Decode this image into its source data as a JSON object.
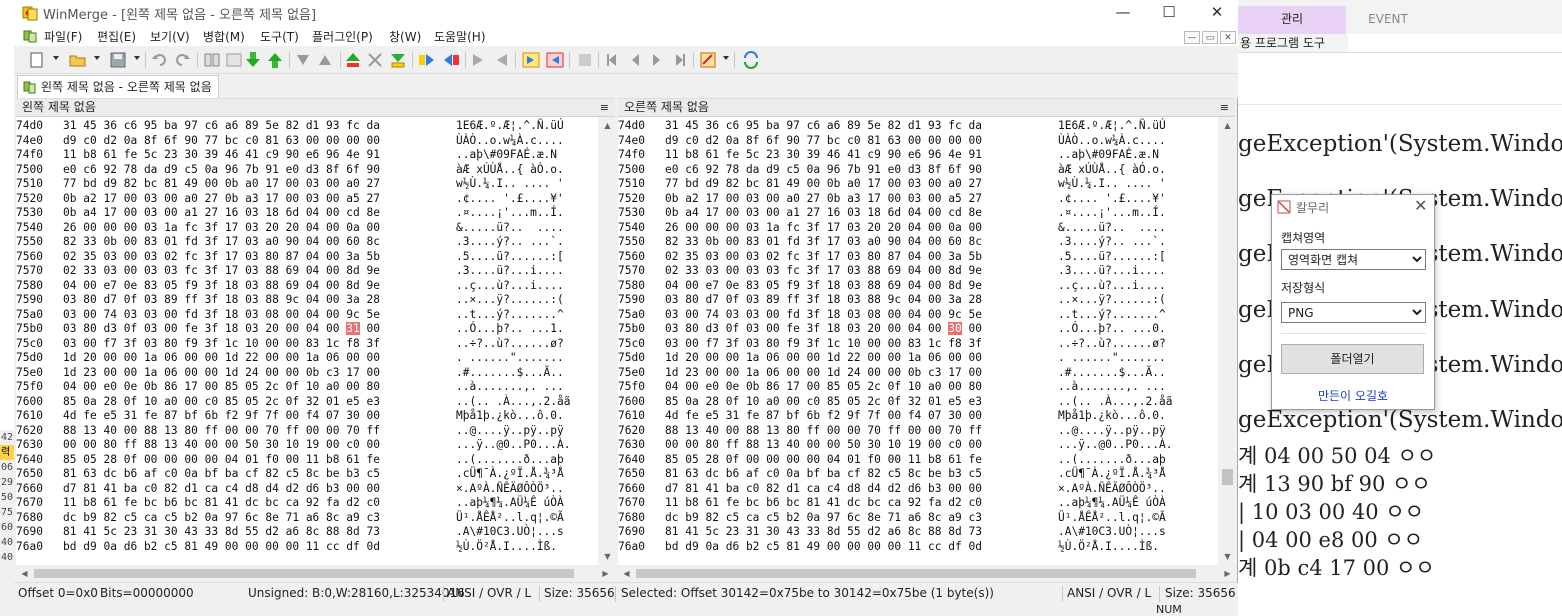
{
  "window": {
    "title": "WinMerge - [왼쪽 제목 없음 - 오른쪽 제목 없음]",
    "minimize": "—",
    "maximize": "☐",
    "close": "✕"
  },
  "menu": [
    "파일(F)",
    "편집(E)",
    "보기(V)",
    "병합(M)",
    "도구(T)",
    "플러그인(P)",
    "창(W)",
    "도움말(H)"
  ],
  "mdi": {
    "minimize": "—",
    "restore": "▭",
    "close": "✕"
  },
  "doc_tab": "왼쪽 제목 없음 - 오른쪽 제목 없음",
  "left_pane": {
    "title": "왼쪽 제목 없음",
    "menu_glyph": "≡"
  },
  "right_pane": {
    "title": "오른쪽 제목 없음",
    "menu_glyph": "≡"
  },
  "hex_rows": [
    {
      "addr": "74d0",
      "hex": [
        "31",
        "45",
        "36",
        "c6",
        "95",
        "ba",
        "97",
        "c6",
        "a6",
        "89",
        "5e",
        "82",
        "d1",
        "93",
        "fc",
        "da"
      ],
      "left_ascii": "1E6Æ.º.Æ¦.^.Ñ.üÚ",
      "right_ascii": "1E6Æ.º.Æ¦.^.Ñ.üÚ"
    },
    {
      "addr": "74e0",
      "hex": [
        "d9",
        "c0",
        "d2",
        "0a",
        "8f",
        "6f",
        "90",
        "77",
        "bc",
        "c0",
        "81",
        "63",
        "00",
        "00",
        "00",
        "00"
      ],
      "left_ascii": "ÙÀÒ..o.w¼À.c....",
      "right_ascii": "ÙÀÒ..o.w¼À.c...."
    },
    {
      "addr": "74f0",
      "hex": [
        "11",
        "b8",
        "61",
        "fe",
        "5c",
        "23",
        "30",
        "39",
        "46",
        "41",
        "c9",
        "90",
        "e6",
        "96",
        "4e",
        "91"
      ],
      "left_ascii": "..aþ\\#09FAÉ.æ.N",
      "right_ascii": "..aþ\\#09FAÉ.æ.N"
    },
    {
      "addr": "7500",
      "hex": [
        "e0",
        "c6",
        "92",
        "78",
        "da",
        "d9",
        "c5",
        "0a",
        "96",
        "7b",
        "91",
        "e0",
        "d3",
        "8f",
        "6f",
        "90"
      ],
      "left_ascii": "àÆ xÚÙÅ..{ àÓ.o.",
      "right_ascii": "àÆ xÚÙÅ..{ àÓ.o."
    },
    {
      "addr": "7510",
      "hex": [
        "77",
        "bd",
        "d9",
        "82",
        "bc",
        "81",
        "49",
        "00",
        "0b",
        "a0",
        "17",
        "00",
        "03",
        "00",
        "a0",
        "27"
      ],
      "left_ascii": "w½Ù.¼.I.. .... '",
      "right_ascii": "w½Ù.¼.I.. .... '"
    },
    {
      "addr": "7520",
      "hex": [
        "0b",
        "a2",
        "17",
        "00",
        "03",
        "00",
        "a0",
        "27",
        "0b",
        "a3",
        "17",
        "00",
        "03",
        "00",
        "a5",
        "27"
      ],
      "left_ascii": ".¢.... '.£....¥'",
      "right_ascii": ".¢.... '.£....¥'"
    },
    {
      "addr": "7530",
      "hex": [
        "0b",
        "a4",
        "17",
        "00",
        "03",
        "00",
        "a1",
        "27",
        "16",
        "03",
        "18",
        "6d",
        "04",
        "00",
        "cd",
        "8e"
      ],
      "left_ascii": ".¤....¡'...m..Í.",
      "right_ascii": ".¤....¡'...m..Í."
    },
    {
      "addr": "7540",
      "hex": [
        "26",
        "00",
        "00",
        "00",
        "03",
        "1a",
        "fc",
        "3f",
        "17",
        "03",
        "20",
        "20",
        "04",
        "00",
        "0a",
        "00"
      ],
      "left_ascii": "&.....ü?..  ....",
      "right_ascii": "&.....ü?..  ...."
    },
    {
      "addr": "7550",
      "hex": [
        "82",
        "33",
        "0b",
        "00",
        "83",
        "01",
        "fd",
        "3f",
        "17",
        "03",
        "a0",
        "90",
        "04",
        "00",
        "60",
        "8c"
      ],
      "left_ascii": ".3....ý?.. ...`.",
      "right_ascii": ".3....ý?.. ...`."
    },
    {
      "addr": "7560",
      "hex": [
        "02",
        "35",
        "03",
        "00",
        "03",
        "02",
        "fc",
        "3f",
        "17",
        "03",
        "80",
        "87",
        "04",
        "00",
        "3a",
        "5b"
      ],
      "left_ascii": ".5....ü?......:[",
      "right_ascii": ".5....ü?......:["
    },
    {
      "addr": "7570",
      "hex": [
        "02",
        "33",
        "03",
        "00",
        "03",
        "03",
        "fc",
        "3f",
        "17",
        "03",
        "88",
        "69",
        "04",
        "00",
        "8d",
        "9e"
      ],
      "left_ascii": ".3....ü?...i....",
      "right_ascii": ".3....ü?...i...."
    },
    {
      "addr": "7580",
      "hex": [
        "04",
        "00",
        "e7",
        "0e",
        "83",
        "05",
        "f9",
        "3f",
        "18",
        "03",
        "88",
        "69",
        "04",
        "00",
        "8d",
        "9e"
      ],
      "left_ascii": "..ç...ù?...i....",
      "right_ascii": "..ç...ù?...i...."
    },
    {
      "addr": "7590",
      "hex": [
        "03",
        "80",
        "d7",
        "0f",
        "03",
        "89",
        "ff",
        "3f",
        "18",
        "03",
        "88",
        "9c",
        "04",
        "00",
        "3a",
        "28"
      ],
      "left_ascii": "..×...ÿ?......:(",
      "right_ascii": "..×...ÿ?......:("
    },
    {
      "addr": "75a0",
      "hex": [
        "03",
        "00",
        "74",
        "03",
        "03",
        "00",
        "fd",
        "3f",
        "18",
        "03",
        "08",
        "00",
        "04",
        "00",
        "9c",
        "5e"
      ],
      "left_ascii": "..t...ý?.......^",
      "right_ascii": "..t...ý?.......^"
    },
    {
      "addr": "75b0",
      "hex": [
        "03",
        "80",
        "d3",
        "0f",
        "03",
        "00",
        "fe",
        "3f",
        "18",
        "03",
        "20",
        "00",
        "04",
        "00",
        "31",
        "00"
      ],
      "left_ascii": "..Ó...þ?.. ...1.",
      "right_ascii": "..Ó...þ?.. ...0."
    },
    {
      "addr": "75c0",
      "hex": [
        "03",
        "00",
        "f7",
        "3f",
        "03",
        "80",
        "f9",
        "3f",
        "1c",
        "10",
        "00",
        "00",
        "83",
        "1c",
        "f8",
        "3f"
      ],
      "left_ascii": "..÷?..ù?......ø?",
      "right_ascii": "..÷?..ù?......ø?"
    },
    {
      "addr": "75d0",
      "hex": [
        "1d",
        "20",
        "00",
        "00",
        "1a",
        "06",
        "00",
        "00",
        "1d",
        "22",
        "00",
        "00",
        "1a",
        "06",
        "00",
        "00"
      ],
      "left_ascii": ". ......\".......",
      "right_ascii": ". ......\"......."
    },
    {
      "addr": "75e0",
      "hex": [
        "1d",
        "23",
        "00",
        "00",
        "1a",
        "06",
        "00",
        "00",
        "1d",
        "24",
        "00",
        "00",
        "0b",
        "c3",
        "17",
        "00"
      ],
      "left_ascii": ".#.......$...Ã..",
      "right_ascii": ".#.......$...Ã.."
    },
    {
      "addr": "75f0",
      "hex": [
        "04",
        "00",
        "e0",
        "0e",
        "0b",
        "86",
        "17",
        "00",
        "85",
        "05",
        "2c",
        "0f",
        "10",
        "a0",
        "00",
        "80"
      ],
      "left_ascii": "..à.......,. ...",
      "right_ascii": "..à.......,. ..."
    },
    {
      "addr": "7600",
      "hex": [
        "85",
        "0a",
        "28",
        "0f",
        "10",
        "a0",
        "00",
        "c0",
        "85",
        "05",
        "2c",
        "0f",
        "32",
        "01",
        "e5",
        "e3"
      ],
      "left_ascii": "..(.. .À...,.2.åã",
      "right_ascii": "..(.. .À...,.2.åã"
    },
    {
      "addr": "7610",
      "hex": [
        "4d",
        "fe",
        "e5",
        "31",
        "fe",
        "87",
        "bf",
        "6b",
        "f2",
        "9f",
        "7f",
        "00",
        "f4",
        "07",
        "30",
        "00"
      ],
      "left_ascii": "Mþå1þ.¿kò...ô.0.",
      "right_ascii": "Mþå1þ.¿kò...ô.0."
    },
    {
      "addr": "7620",
      "hex": [
        "88",
        "13",
        "40",
        "00",
        "88",
        "13",
        "80",
        "ff",
        "00",
        "00",
        "70",
        "ff",
        "00",
        "00",
        "70",
        "ff"
      ],
      "left_ascii": "..@....ÿ..pÿ..pÿ",
      "right_ascii": "..@....ÿ..pÿ..pÿ"
    },
    {
      "addr": "7630",
      "hex": [
        "00",
        "00",
        "80",
        "ff",
        "88",
        "13",
        "40",
        "00",
        "00",
        "50",
        "30",
        "10",
        "19",
        "00",
        "c0",
        "00"
      ],
      "left_ascii": "...ÿ..@0..P0...À.",
      "right_ascii": "...ÿ..@0..P0...À."
    },
    {
      "addr": "7640",
      "hex": [
        "85",
        "05",
        "28",
        "0f",
        "00",
        "00",
        "00",
        "00",
        "04",
        "01",
        "f0",
        "00",
        "11",
        "b8",
        "61",
        "fe"
      ],
      "left_ascii": "..(.......ð...aþ",
      "right_ascii": "..(.......ð...aþ"
    },
    {
      "addr": "7650",
      "hex": [
        "81",
        "63",
        "dc",
        "b6",
        "af",
        "c0",
        "0a",
        "bf",
        "ba",
        "cf",
        "82",
        "c5",
        "8c",
        "be",
        "b3",
        "c5"
      ],
      "left_ascii": ".cÜ¶¯À.¿ºÏ.Å.¾³Å",
      "right_ascii": ".cÜ¶¯À.¿ºÏ.Å.¾³Å"
    },
    {
      "addr": "7660",
      "hex": [
        "d7",
        "81",
        "41",
        "ba",
        "c0",
        "82",
        "d1",
        "ca",
        "c4",
        "d8",
        "d4",
        "d2",
        "d6",
        "b3",
        "00",
        "00"
      ],
      "left_ascii": "×.AºÀ.ÑÊÄØÔÒÖ³..",
      "right_ascii": "×.AºÀ.ÑÊÄØÔÒÖ³.."
    },
    {
      "addr": "7670",
      "hex": [
        "11",
        "b8",
        "61",
        "fe",
        "bc",
        "b6",
        "bc",
        "81",
        "41",
        "dc",
        "bc",
        "ca",
        "92",
        "fa",
        "d2",
        "c0"
      ],
      "left_ascii": "..aþ¼¶¼.AÜ¼Ê úÒÀ",
      "right_ascii": "..aþ¼¶¼.AÜ¼Ê úÒÀ"
    },
    {
      "addr": "7680",
      "hex": [
        "dc",
        "b9",
        "82",
        "c5",
        "ca",
        "c5",
        "b2",
        "0a",
        "97",
        "6c",
        "8e",
        "71",
        "a6",
        "8c",
        "a9",
        "c3"
      ],
      "left_ascii": "Ü¹.ÅÊÅ²..l.q¦.©Ã",
      "right_ascii": "Ü¹.ÅÊÅ²..l.q¦.©Ã"
    },
    {
      "addr": "7690",
      "hex": [
        "81",
        "41",
        "5c",
        "23",
        "31",
        "30",
        "43",
        "33",
        "8d",
        "55",
        "d2",
        "a6",
        "8c",
        "88",
        "8d",
        "73"
      ],
      "left_ascii": ".A\\#10C3.UÒ¦...s",
      "right_ascii": ".A\\#10C3.UÒ¦...s"
    },
    {
      "addr": "76a0",
      "hex": [
        "bd",
        "d9",
        "0a",
        "d6",
        "b2",
        "c5",
        "81",
        "49",
        "00",
        "00",
        "00",
        "00",
        "11",
        "cc",
        "df",
        "0d"
      ],
      "left_ascii": "½Ù.Ö²Å.I....Ìß.",
      "right_ascii": "½Ù.Ö²Å.I....Ìß."
    }
  ],
  "diff": {
    "row_index": 14,
    "byte_index": 14,
    "left_value": "31",
    "right_value": "30",
    "left_char": "1",
    "right_char": "0"
  },
  "status": {
    "offset": "Offset 0=0x0",
    "bits": "Bits=00000000",
    "unsigned": "Unsigned: B:0,W:28160,L:32534016",
    "left_mode": "ANSI / OVR / L",
    "left_size": "Size: 35656",
    "selected": "Selected: Offset 30142=0x75be to 30142=0x75be (1 byte(s))",
    "right_mode": "ANSI / OVR / L",
    "right_size": "Size: 35656",
    "num": "NUM"
  },
  "capture_dialog": {
    "title": "칼무리",
    "close": "✕",
    "area_label": "캡쳐영역",
    "area_value": "영역화면 캡쳐",
    "format_label": "저장형식",
    "format_value": "PNG",
    "open_folder": "폴더열기",
    "credit_link": "만든이 오길호"
  },
  "background_app": {
    "tab_active": "관리",
    "tab_other": "EVENT",
    "ribbon_label": "용 프로그램 도구",
    "lines": [
      "geException'(System.Windows.",
      "geException'(System.Windows.",
      "geException'(System.Windows.",
      "geException'(System.Windows.",
      "geException'(System.Windows.",
      "geException'(System.Windows.",
      "계 04 00 50 04 ㅇㅇ",
      "계 13 90 bf 90 ㅇㅇ",
      "| 10 03 00 40 ㅇㅇ",
      "| 04 00 e8 00 ㅇㅇ",
      "계 0b c4 17 00 ㅇㅇ"
    ]
  },
  "left_edge": [
    "42",
    "력",
    "06",
    "29",
    "50",
    "75",
    "60",
    "40",
    "40"
  ],
  "colors": {
    "diff": "#e77070",
    "tab_active": "#e9d2f5",
    "link": "#1a3fc8"
  }
}
